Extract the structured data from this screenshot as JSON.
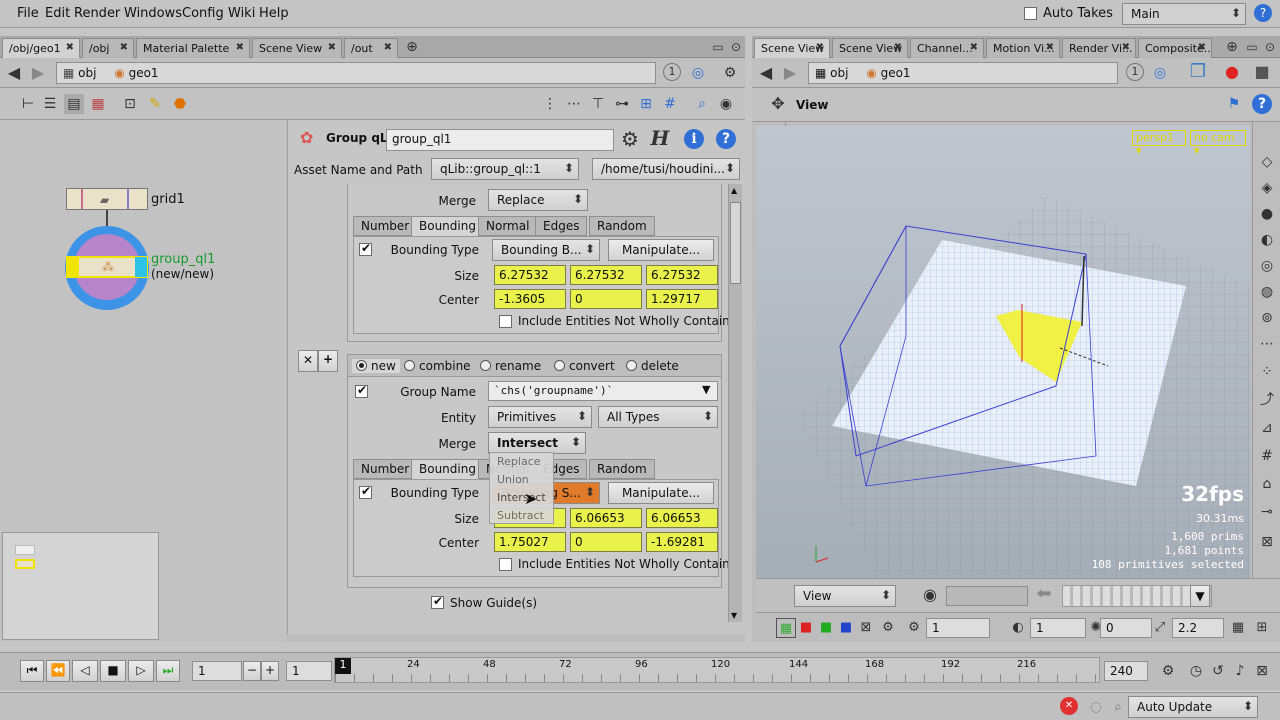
{
  "menu": [
    "File",
    "Edit",
    "Render",
    "Windows",
    "Config",
    "Wiki",
    "Help"
  ],
  "auto_takes": "Auto Takes",
  "desktop": "Main",
  "left_tabs": [
    "/obj/geo1",
    "/obj",
    "Material Palette",
    "Scene View",
    "/out"
  ],
  "right_tabs": [
    "Scene View",
    "Scene View",
    "Channel...",
    "Motion Vi...",
    "Render Vi...",
    "Composite..."
  ],
  "path": {
    "obj": "obj",
    "geo": "geo1",
    "count": "1"
  },
  "nodes": {
    "grid": "grid1",
    "group": "group_ql1",
    "group_sub": "(new/new)"
  },
  "params": {
    "node_type": "Group qL",
    "node_name": "group_ql1",
    "asset_label": "Asset Name and Path",
    "asset_name": "qLib::group_ql::1",
    "asset_path": "/home/tusi/houdini...",
    "merge_label": "Merge",
    "bounding_type_label": "Bounding Type",
    "size_label": "Size",
    "center_label": "Center",
    "include_label": "Include Entities Not Wholly Contain...",
    "manipulate": "Manipulate...",
    "subtabs": [
      "Number",
      "Bounding",
      "Normal",
      "Edges",
      "Random"
    ],
    "block1": {
      "merge": "Replace",
      "bounding_type": "Bounding B...",
      "size": [
        "6.27532",
        "6.27532",
        "6.27532"
      ],
      "center": [
        "-1.3605",
        "0",
        "1.29717"
      ]
    },
    "modes": [
      "new",
      "combine",
      "rename",
      "convert",
      "delete"
    ],
    "block2": {
      "group_name_label": "Group Name",
      "group_name": "`chs('groupname')`",
      "entity_label": "Entity",
      "entity": "Primitives",
      "entity_types": "All Types",
      "merge": "Intersect",
      "bounding_type": "Bounding S...",
      "size": [
        "",
        "6.06653",
        "6.06653"
      ],
      "center": [
        "1.75027",
        "0",
        "-1.69281"
      ]
    },
    "show_guides": "Show Guide(s)",
    "merge_options": [
      "Replace",
      "Union",
      "Intersect",
      "Subtract"
    ]
  },
  "viewer": {
    "title": "View",
    "camera": "persp1",
    "nocam": "no cam",
    "fps": "32fps",
    "ms": "30.31ms",
    "prims": "1,600  prims",
    "points": "1,681 points",
    "selected": "108 primitives selected",
    "view_menu": "View",
    "bottom_vals": [
      "1",
      "1",
      "0",
      "2.2"
    ]
  },
  "timeline": {
    "frame": "1",
    "start": "1",
    "end": "240",
    "current": "1",
    "ticks": [
      "24",
      "48",
      "72",
      "96",
      "120",
      "144",
      "168",
      "192",
      "216"
    ]
  },
  "status": {
    "update": "Auto Update"
  }
}
